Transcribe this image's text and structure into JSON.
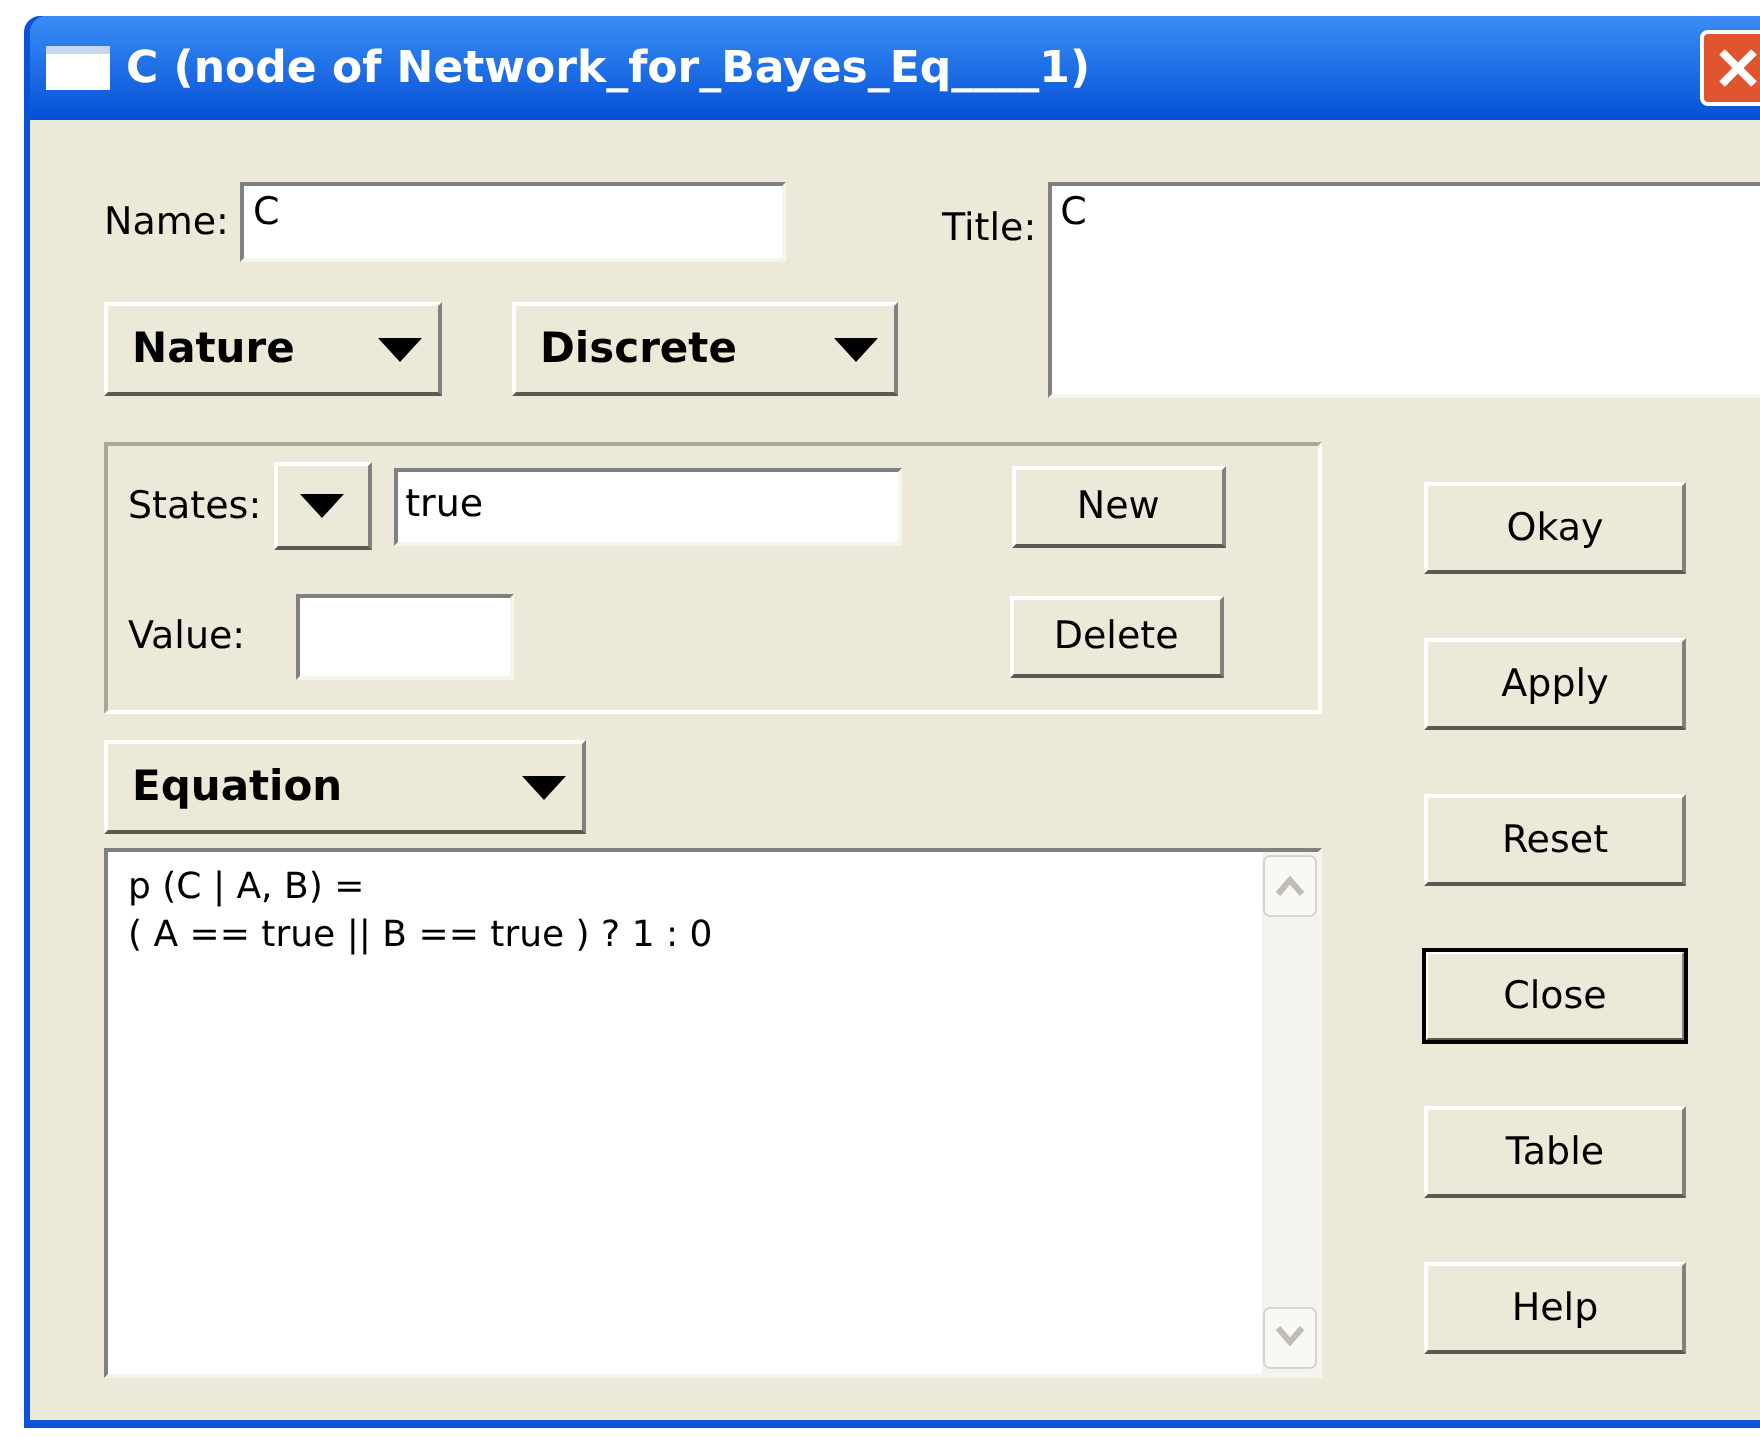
{
  "window": {
    "title": "C (node of Network_for_Bayes_Eq____1)"
  },
  "name_field": {
    "label": "Name:",
    "value": "C"
  },
  "title_field": {
    "label": "Title:",
    "value": "C"
  },
  "dropdowns": [
    {
      "label": "Nature"
    },
    {
      "label": "Discrete"
    }
  ],
  "states": {
    "label": "States:",
    "value": "true"
  },
  "value_field": {
    "label": "Value:"
  },
  "state_buttons": [
    {
      "label": "New"
    },
    {
      "label": "Delete"
    }
  ],
  "equation_dropdown": {
    "label": "Equation"
  },
  "equation": {
    "lines": [
      "p (C | A, B) =",
      "( A == true || B == true ) ? 1 : 0"
    ]
  },
  "side_buttons": [
    {
      "label": "Okay",
      "default": false
    },
    {
      "label": "Apply",
      "default": false
    },
    {
      "label": "Reset",
      "default": false
    },
    {
      "label": "Close",
      "default": true
    },
    {
      "label": "Table",
      "default": false
    },
    {
      "label": "Help",
      "default": false
    }
  ]
}
